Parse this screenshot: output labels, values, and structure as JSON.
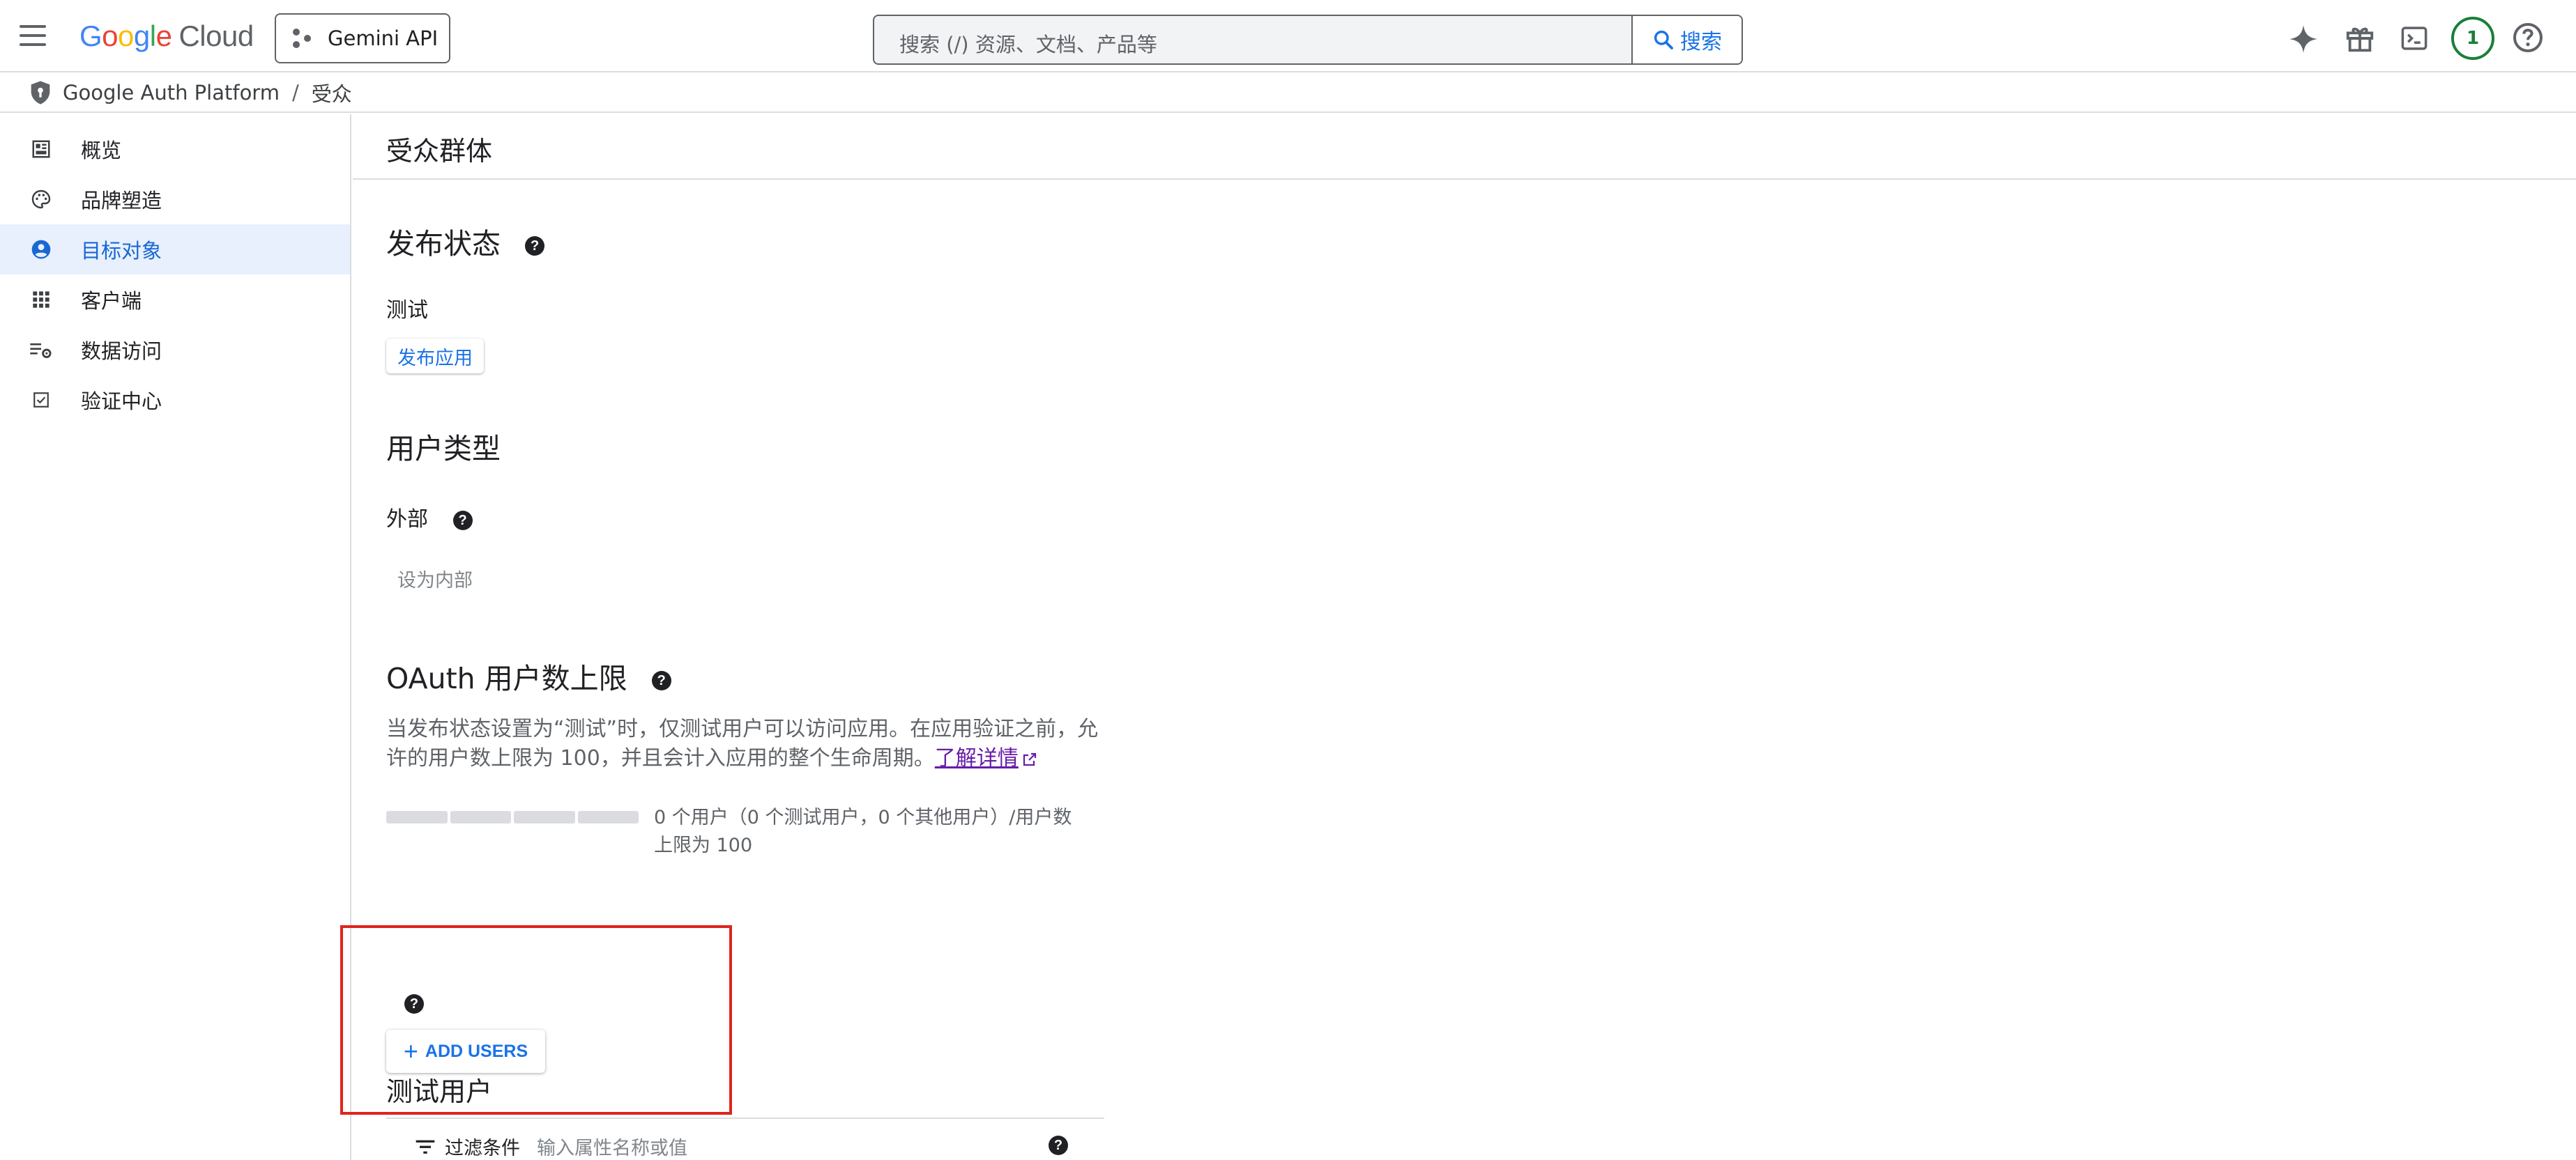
{
  "topbar": {
    "logo_google": [
      "G",
      "o",
      "o",
      "g",
      "l",
      "e"
    ],
    "logo_cloud": "Cloud",
    "project_label": "Gemini API",
    "search_placeholder": "搜索 (/) 资源、文档、产品等",
    "search_button": "搜索",
    "notification_count": "1"
  },
  "breadcrumb": {
    "root": "Google Auth Platform",
    "separator": "/",
    "current": "受众"
  },
  "sidebar": {
    "items": [
      {
        "label": "概览",
        "icon": "dashboard-icon",
        "active": false
      },
      {
        "label": "品牌塑造",
        "icon": "palette-icon",
        "active": false
      },
      {
        "label": "目标对象",
        "icon": "person-circle-icon",
        "active": true
      },
      {
        "label": "客户端",
        "icon": "apps-grid-icon",
        "active": false
      },
      {
        "label": "数据访问",
        "icon": "data-settings-icon",
        "active": false
      },
      {
        "label": "验证中心",
        "icon": "checkbox-icon",
        "active": false
      }
    ]
  },
  "main": {
    "title": "受众群体",
    "publishing": {
      "heading": "发布状态",
      "status": "测试",
      "button": "发布应用"
    },
    "user_type": {
      "heading": "用户类型",
      "value": "外部",
      "button": "设为内部"
    },
    "oauth_limit": {
      "heading": "OAuth 用户数上限",
      "description": "当发布状态设置为“测试”时，仅测试用户可以访问应用。在应用验证之前，允许的用户数上限为 100，并且会计入应用的整个生命周期。",
      "link": "了解详情",
      "progress_fraction": 0,
      "progress_text": "0 个用户（0 个测试用户，0 个其他用户）/用户数上限为 100"
    },
    "test_users": {
      "heading": "测试用户",
      "add_button": "ADD USERS"
    },
    "filter": {
      "label": "过滤条件",
      "placeholder": "输入属性名称或值"
    }
  },
  "colors": {
    "accent": "#1a73e8",
    "active_bg": "#e8f0fe",
    "highlight": "#e0241c",
    "avatar": "#188038"
  }
}
